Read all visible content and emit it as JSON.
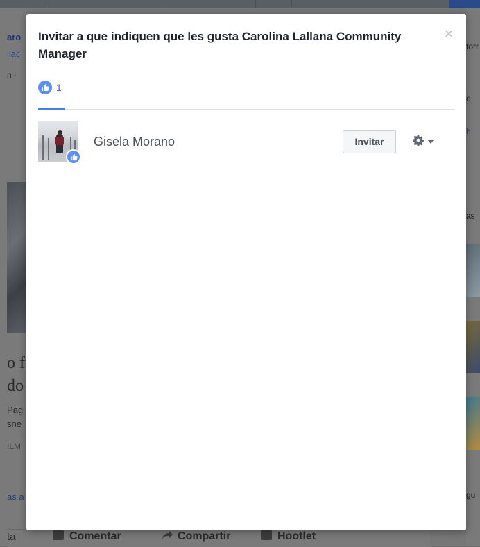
{
  "modal": {
    "title": "Invitar a que indiquen que les gusta Carolina Lallana Community Manager",
    "close_symbol": "×",
    "tabs": [
      {
        "icon": "like-icon",
        "count": "1",
        "active": true
      }
    ],
    "people": [
      {
        "name": "Gisela Morano",
        "invite_label": "Invitar",
        "badge_icon": "like-icon"
      }
    ]
  },
  "background": {
    "left_fragments": [
      "aro",
      "llac",
      "n ·",
      "o fu",
      "do",
      "Pag",
      "sne",
      "ILM",
      "as a",
      "ta"
    ],
    "right_fragments": [
      "forr",
      "o",
      "h",
      "as",
      "gu"
    ],
    "bottom_actions": [
      {
        "label": "Comentar",
        "icon": "comment-icon"
      },
      {
        "label": "Compartir",
        "icon": "share-icon"
      },
      {
        "label": "Hootlet",
        "icon": "hootlet-icon"
      }
    ]
  },
  "colors": {
    "accent": "#4080ff",
    "like_blue": "#5890ff",
    "overlay": "#777777"
  }
}
